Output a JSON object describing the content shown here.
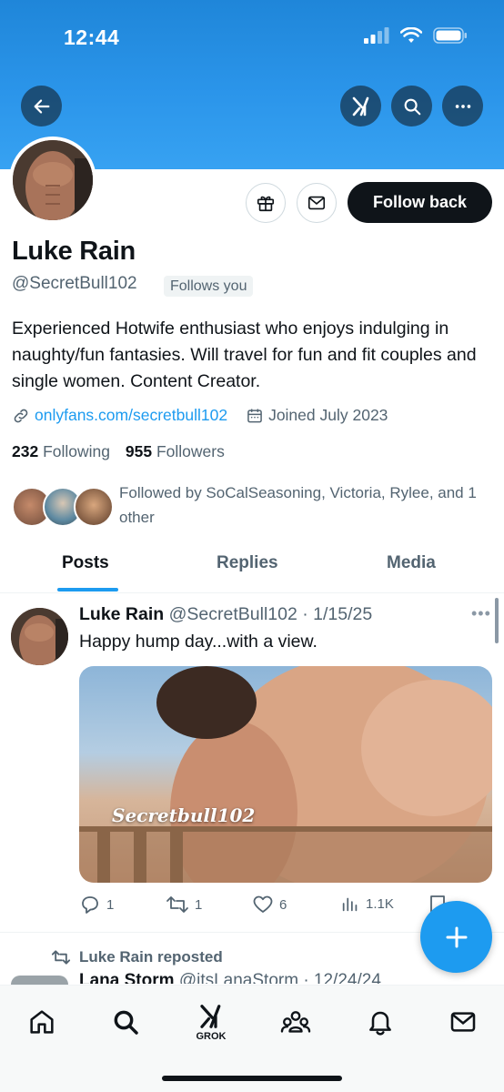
{
  "status_bar": {
    "time": "12:44"
  },
  "profile": {
    "name": "Luke Rain",
    "handle": "@SecretBull102",
    "follows_you": "Follows you",
    "follow_back_label": "Follow back",
    "bio": "Experienced Hotwife enthusiast who enjoys indulging in naughty/fun fantasies. Will travel for fun and fit couples and single women. Content Creator.",
    "link": "onlyfans.com/secretbull102",
    "joined": "Joined July 2023",
    "following_count": "232",
    "following_label": "Following",
    "followers_count": "955",
    "followers_label": "Followers",
    "followed_by": "Followed by SoCalSeasoning, Victoria, Rylee, and 1 other"
  },
  "tabs": [
    {
      "label": "Posts",
      "active": true
    },
    {
      "label": "Replies",
      "active": false
    },
    {
      "label": "Media",
      "active": false
    }
  ],
  "post": {
    "author": "Luke Rain",
    "handle_date": "@SecretBull102 · 1/15/25",
    "text": "Happy hump day...with a view.",
    "media_watermark": "Secretbull102",
    "replies": "1",
    "reposts": "1",
    "likes": "6",
    "views": "1.1K"
  },
  "next_post": {
    "repost_label": "Luke Rain reposted",
    "author": "Lana Storm",
    "handle_date": "@itsLanaStorm · 12/24/24"
  },
  "nav": {
    "grok_label": "GROK"
  },
  "colors": {
    "accent": "#1d9bf0",
    "banner": "#2b95ea",
    "text": "#0f1419",
    "secondary": "#536471"
  }
}
